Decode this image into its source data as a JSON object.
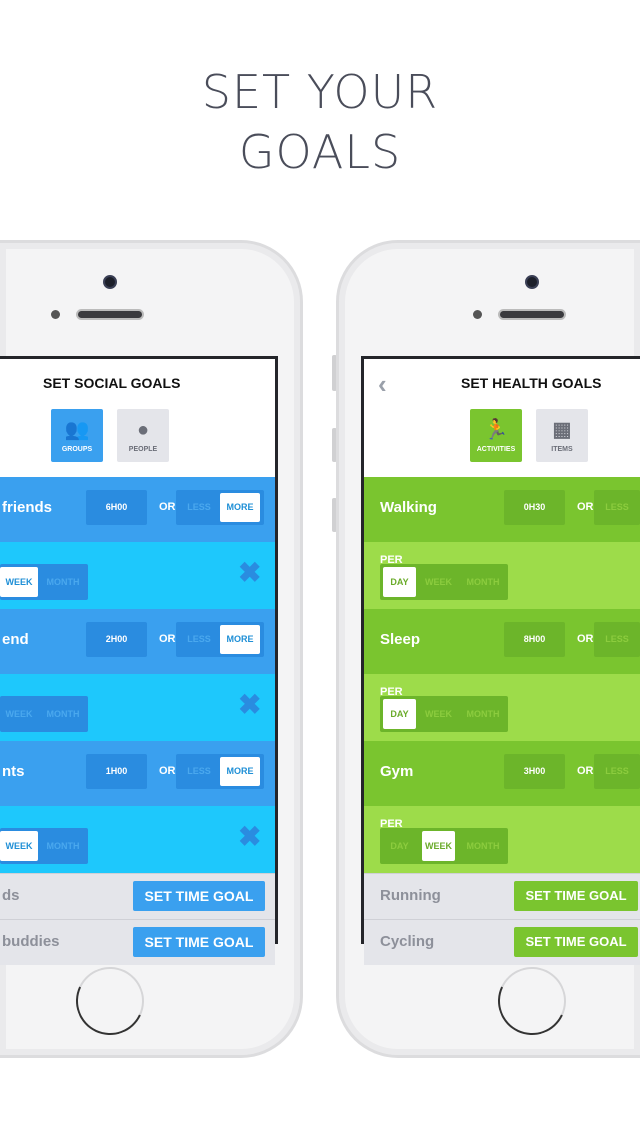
{
  "headline": {
    "line1": "SET YOUR",
    "line2": "GOALS"
  },
  "colors": {
    "social_row": "#3aa0ef",
    "social_sub": "#1ec8fc",
    "social_pill": "#2a8ce0",
    "health_row": "#7ac52f",
    "health_sub": "#9ddc4a",
    "health_pill": "#6cb52a",
    "text_dark": "#4a4d5a"
  },
  "social": {
    "title": "SET SOCIAL GOALS",
    "tabs": [
      {
        "label": "GROUPS",
        "icon": "groups-icon",
        "active": true
      },
      {
        "label": "PEOPLE",
        "icon": "person-icon",
        "active": false
      }
    ],
    "goals": [
      {
        "name": "friends",
        "time": "6H00",
        "or": "OR",
        "less": "LESS",
        "more": "MORE",
        "selected": "MORE",
        "periods": [
          "WEEK",
          "MONTH"
        ],
        "period_selected": "WEEK"
      },
      {
        "name": "end",
        "time": "2H00",
        "or": "OR",
        "less": "LESS",
        "more": "MORE",
        "selected": "MORE",
        "periods": [
          "WEEK",
          "MONTH"
        ],
        "period_selected": null
      },
      {
        "name": "nts",
        "time": "1H00",
        "or": "OR",
        "less": "LESS",
        "more": "MORE",
        "selected": "MORE",
        "periods": [
          "WEEK",
          "MONTH"
        ],
        "period_selected": "WEEK"
      }
    ],
    "others": [
      {
        "name": "ds",
        "button": "SET TIME GOAL"
      },
      {
        "name": "buddies",
        "button": "SET TIME GOAL"
      }
    ]
  },
  "health": {
    "title": "SET HEALTH GOALS",
    "tabs": [
      {
        "label": "ACTIVITIES",
        "icon": "running-icon",
        "active": true
      },
      {
        "label": "ITEMS",
        "icon": "grid-icon",
        "active": false
      }
    ],
    "goals": [
      {
        "name": "Walking",
        "time": "0H30",
        "or": "OR",
        "less": "LESS",
        "per": "PER",
        "periods": [
          "DAY",
          "WEEK",
          "MONTH"
        ],
        "period_selected": "DAY"
      },
      {
        "name": "Sleep",
        "time": "8H00",
        "or": "OR",
        "less": "LESS",
        "per": "PER",
        "periods": [
          "DAY",
          "WEEK",
          "MONTH"
        ],
        "period_selected": "DAY"
      },
      {
        "name": "Gym",
        "time": "3H00",
        "or": "OR",
        "less": "LESS",
        "per": "PER",
        "periods": [
          "DAY",
          "WEEK",
          "MONTH"
        ],
        "period_selected": "WEEK"
      }
    ],
    "others": [
      {
        "name": "Running",
        "button": "SET TIME GOAL"
      },
      {
        "name": "Cycling",
        "button": "SET TIME GOAL"
      }
    ]
  }
}
